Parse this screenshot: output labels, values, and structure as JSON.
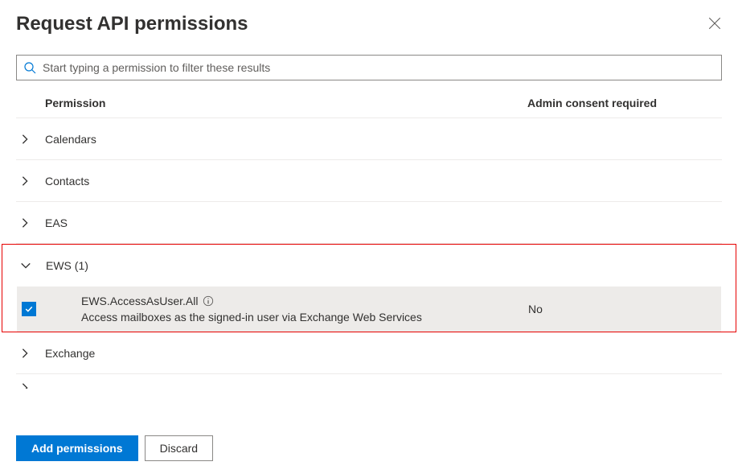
{
  "header": {
    "title": "Request API permissions"
  },
  "search": {
    "placeholder": "Start typing a permission to filter these results"
  },
  "columns": {
    "permission": "Permission",
    "admin": "Admin consent required"
  },
  "groups": {
    "calendars": "Calendars",
    "contacts": "Contacts",
    "eas": "EAS",
    "ews_expanded": "EWS (1)",
    "exchange": "Exchange"
  },
  "ews_item": {
    "name": "EWS.AccessAsUser.All",
    "desc": "Access mailboxes as the signed-in user via Exchange Web Services",
    "admin": "No"
  },
  "buttons": {
    "add": "Add permissions",
    "discard": "Discard"
  }
}
